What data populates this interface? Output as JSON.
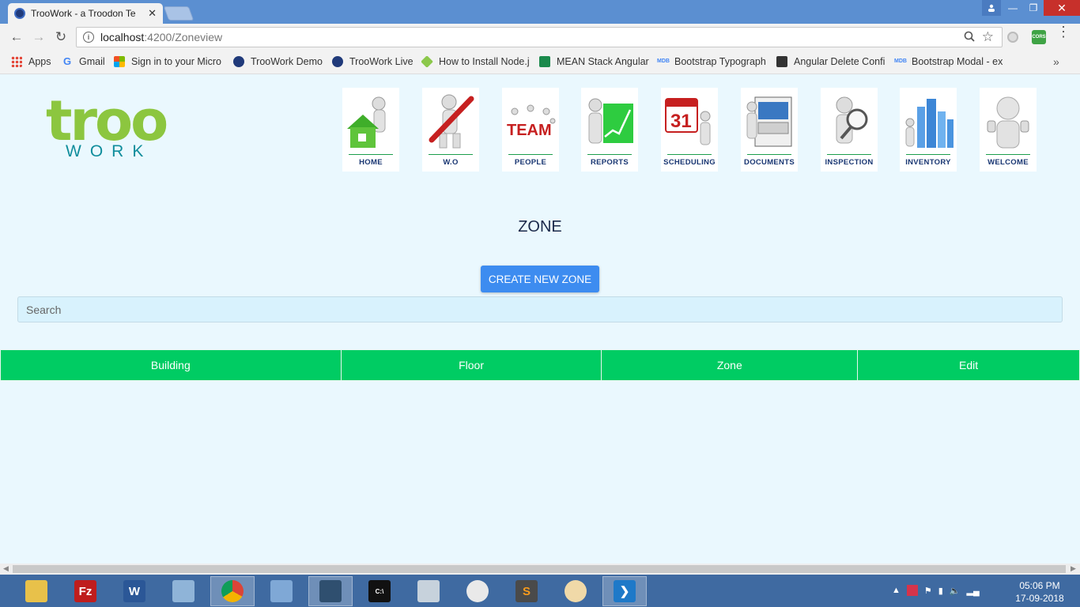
{
  "browser": {
    "tab_title": "TrooWork - a Troodon Te",
    "url_host": "localhost",
    "url_path": ":4200/Zoneview",
    "bookmarks": [
      {
        "label": "Apps",
        "icon": "apps-grid-icon",
        "color": "#e34133"
      },
      {
        "label": "Gmail",
        "icon": "google-icon",
        "color": "#4285f4"
      },
      {
        "label": "Sign in to your Micro",
        "icon": "microsoft-icon",
        "color": "#f25022"
      },
      {
        "label": "TrooWork Demo",
        "icon": "troowork-icon",
        "color": "#203a7a"
      },
      {
        "label": "TrooWork Live",
        "icon": "troowork-icon",
        "color": "#203a7a"
      },
      {
        "label": "How to Install Node.j",
        "icon": "nodejs-icon",
        "color": "#8cc84b"
      },
      {
        "label": "MEAN Stack Angular",
        "icon": "djam-icon",
        "color": "#1b8a4c"
      },
      {
        "label": "Bootstrap Typograph",
        "icon": "mdb-icon",
        "color": "#4285f4"
      },
      {
        "label": "Angular Delete Confi",
        "icon": "bootstrap-icon",
        "color": "#333333"
      },
      {
        "label": "Bootstrap Modal - ex",
        "icon": "mdb-icon",
        "color": "#4285f4"
      }
    ],
    "cors_badge": "CORS"
  },
  "logo": {
    "top": "troo",
    "bottom": "WORK"
  },
  "nav": [
    {
      "label": "HOME",
      "icon": "home-icon"
    },
    {
      "label": "W.O",
      "icon": "wrench-icon"
    },
    {
      "label": "PEOPLE",
      "icon": "team-icon"
    },
    {
      "label": "REPORTS",
      "icon": "reports-chart-icon"
    },
    {
      "label": "SCHEDULING",
      "icon": "calendar-icon",
      "day": "31"
    },
    {
      "label": "DOCUMENTS",
      "icon": "documents-cabinet-icon"
    },
    {
      "label": "INSPECTION",
      "icon": "magnifier-icon"
    },
    {
      "label": "INVENTORY",
      "icon": "buildings-icon"
    },
    {
      "label": "WELCOME",
      "icon": "thumbs-up-icon"
    }
  ],
  "page": {
    "title": "ZONE",
    "create_button": "CREATE NEW ZONE",
    "search_placeholder": "Search"
  },
  "table": {
    "columns": [
      "Building",
      "Floor",
      "Zone",
      "Edit"
    ]
  },
  "taskbar": {
    "apps": [
      "file-explorer-icon",
      "filezilla-icon",
      "word-icon",
      "notepad-icon",
      "chrome-icon",
      "virtualbox-icon",
      "mysql-workbench-icon",
      "cmd-icon",
      "calculator-icon",
      "snipping-tool-icon",
      "sublime-text-icon",
      "paint-icon",
      "vscode-icon"
    ],
    "time": "05:06 PM",
    "date": "17-09-2018"
  },
  "colors": {
    "accent": "#00cc63",
    "button": "#3d8cf0",
    "logo_green": "#8cc63f",
    "logo_teal": "#0f8d9c"
  }
}
